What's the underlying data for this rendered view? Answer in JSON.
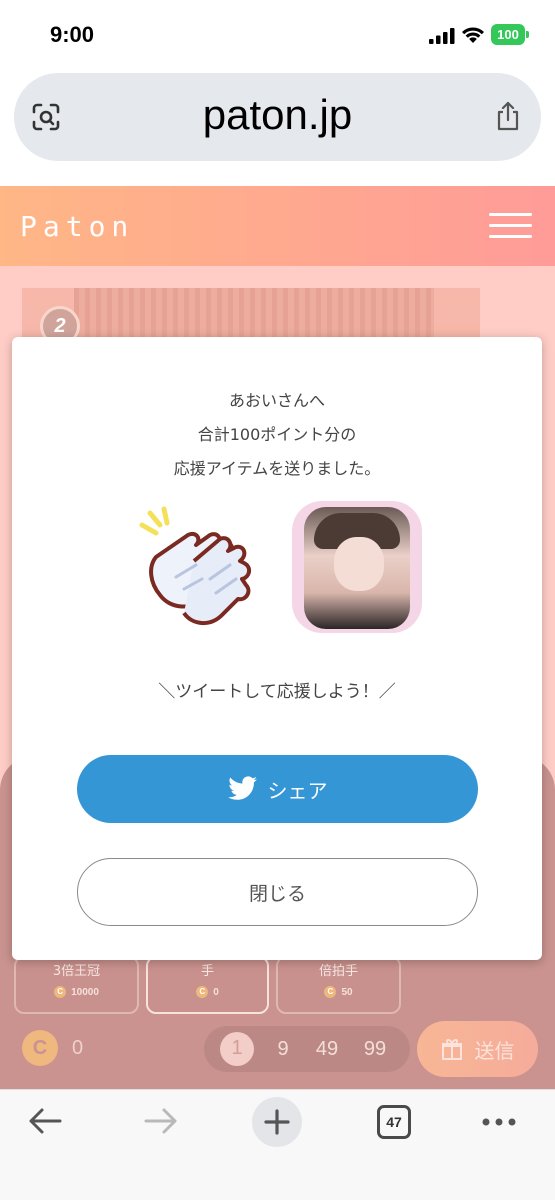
{
  "status_bar": {
    "time": "9:00",
    "battery": "100"
  },
  "browser": {
    "url": "paton.jp",
    "tab_count": "47"
  },
  "site": {
    "logo": "Paton",
    "rank": "2",
    "gifts": [
      {
        "name": "3倍王冠",
        "cost": "10000"
      },
      {
        "name": "手",
        "cost": "0"
      },
      {
        "name": "倍拍手",
        "cost": "50"
      }
    ],
    "coin_label": "C",
    "coin_balance": "0",
    "quantities": [
      "1",
      "9",
      "49",
      "99"
    ],
    "send_label": "送信"
  },
  "modal": {
    "message_lines": [
      "あおいさんへ",
      "合計100ポイント分の",
      "応援アイテムを送りました。"
    ],
    "tweet_prompt": "＼ツイートして応援しよう！／",
    "share_label": "シェア",
    "close_label": "閉じる"
  },
  "colors": {
    "header_gradient_start": "#ff9f5e",
    "header_gradient_end": "#ff7a76",
    "share_button": "#3596d6",
    "battery": "#34c759"
  },
  "icons": [
    "signal-icon",
    "wifi-icon",
    "scan-icon",
    "share-icon",
    "menu-icon",
    "clap-icon",
    "twitter-icon",
    "gift-icon",
    "back-icon",
    "forward-icon",
    "plus-icon",
    "more-icon"
  ]
}
